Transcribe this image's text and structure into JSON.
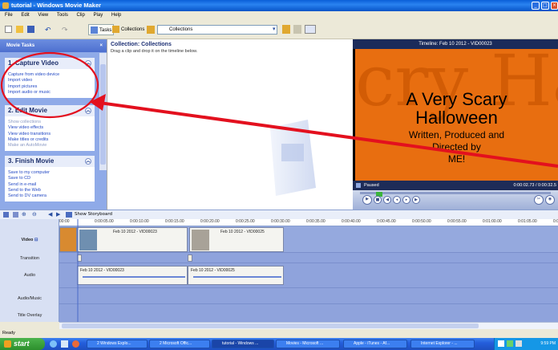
{
  "window": {
    "title": "tutorial - Windows Movie Maker"
  },
  "menu": [
    "File",
    "Edit",
    "View",
    "Tools",
    "Clip",
    "Play",
    "Help"
  ],
  "toolbar": {
    "tasks_label": "Tasks",
    "collections_label": "Collections",
    "collection_select": "Collections"
  },
  "movie_tasks": {
    "header": "Movie Tasks",
    "close": "×",
    "sections": [
      {
        "title": "1. Capture Video",
        "links": [
          "Capture from video device",
          "Import video",
          "Import pictures",
          "Import audio or music"
        ]
      },
      {
        "title": "2. Edit Movie",
        "links": [
          "Show collections",
          "View video effects",
          "View video transitions",
          "Make titles or credits",
          "Make an AutoMovie"
        ]
      },
      {
        "title": "3. Finish Movie",
        "links": [
          "Save to my computer",
          "Save to CD",
          "Send in e-mail",
          "Send to the Web",
          "Send to DV camera"
        ]
      }
    ]
  },
  "collection": {
    "title": "Collection: Collections",
    "subtitle": "Drag a clip and drop it on the timeline below."
  },
  "preview": {
    "title": "Timeline: Feb 10 2012 - VID00023",
    "video_text": [
      "A Very Scary",
      "Halloween",
      "Written, Produced and",
      "Directed by",
      "ME!"
    ],
    "video_bg_text": "cry Ha",
    "status": "Paused",
    "time": "0:00:02.73 / 0:00:32.5",
    "seek_progress": 0.085
  },
  "timeline": {
    "storyboard_label": "Show Storyboard",
    "ruler": [
      "00:00",
      "0:00:05.00",
      "0:00:10.00",
      "0:00:15.00",
      "0:00:20.00",
      "0:00:25.00",
      "0:00:30.00",
      "0:00:35.00",
      "0:00:40.00",
      "0:00:45.00",
      "0:00:50.00",
      "0:00:55.00",
      "0:01:00.00",
      "0:01:05.00",
      "0:01:10.00"
    ],
    "tracks": [
      "Video",
      "Transition",
      "Audio",
      "Audio/Music",
      "Title Overlay"
    ],
    "video_clips": [
      "Feb 10 2012 - VID00023",
      "Feb 10 2012 - VID00025"
    ],
    "audio_clips": [
      "Feb 10 2012 - VID00023",
      "Feb 10 2012 - VID00025"
    ]
  },
  "statusbar": {
    "text": "Ready"
  },
  "taskbar": {
    "start": "start",
    "items": [
      "2 Windows Explo...",
      "2 Microsoft Offic...",
      "tutorial - Windows ...",
      "Movies - Microsoft ...",
      "Apple - iTunes - Af...",
      "Internet Explorer - ..."
    ],
    "clock": "9:59 PM"
  },
  "colors": {
    "annotation": "#e3101e",
    "video_bg": "#e86e10",
    "taskbar": "#245edb"
  }
}
